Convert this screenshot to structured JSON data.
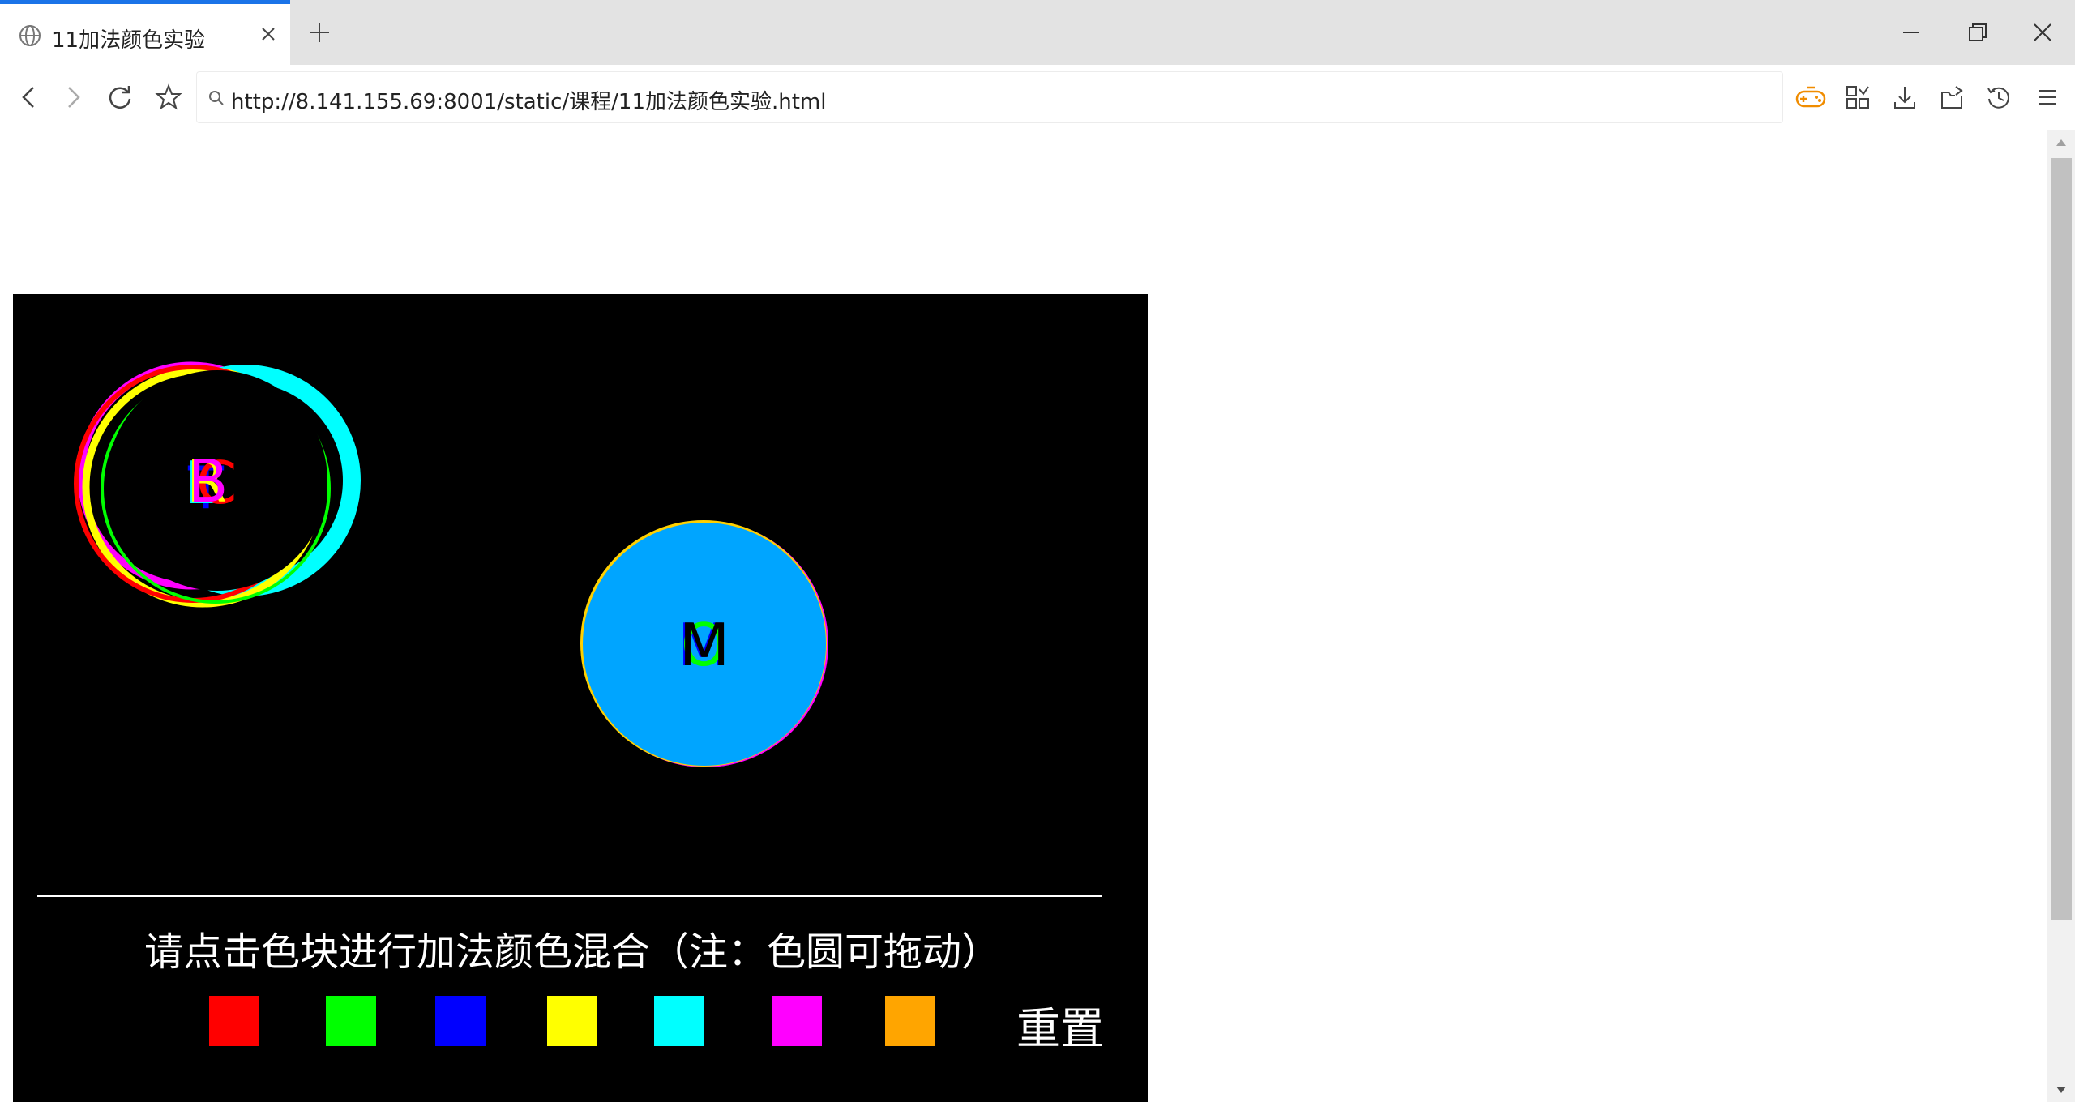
{
  "browser": {
    "tab": {
      "title": "11加法颜色实验"
    },
    "url": "http://8.141.155.69:8001/static/课程/11加法颜色实验.html",
    "icons": {
      "favicon": "globe-icon",
      "close": "close-icon",
      "new_tab": "plus-icon",
      "minimize": "minimize-icon",
      "restore": "restore-icon",
      "window_close": "close-icon",
      "back": "back-icon",
      "forward": "forward-icon",
      "reload": "reload-icon",
      "bookmark": "star-icon",
      "games": "gamepad-icon",
      "apps": "grid-icon",
      "download": "download-icon",
      "share": "share-icon",
      "history": "history-icon",
      "menu": "menu-icon"
    }
  },
  "experiment": {
    "instruction": "请点击色块进行加法颜色混合（注：色圆可拖动）",
    "reset_label": "重置",
    "swatches": [
      {
        "name": "red",
        "color": "#ff0000"
      },
      {
        "name": "green",
        "color": "#00ff00"
      },
      {
        "name": "blue",
        "color": "#0000ff"
      },
      {
        "name": "yellow",
        "color": "#ffff00"
      },
      {
        "name": "cyan",
        "color": "#00ffff"
      },
      {
        "name": "magenta",
        "color": "#ff00ff"
      },
      {
        "name": "orange",
        "color": "#ffa500"
      }
    ],
    "ring_group": {
      "labels": [
        "B",
        "C",
        "L",
        "R",
        "T"
      ],
      "colors": [
        "#ff00ff",
        "#00ffff",
        "#ffff00",
        "#ff0000",
        "#00ff00"
      ]
    },
    "filled_circle": {
      "fill": "#00a5ff",
      "labels": [
        "M",
        "O"
      ],
      "label_colors": [
        "#000000",
        "#00ff00",
        "#0000ff"
      ]
    }
  }
}
